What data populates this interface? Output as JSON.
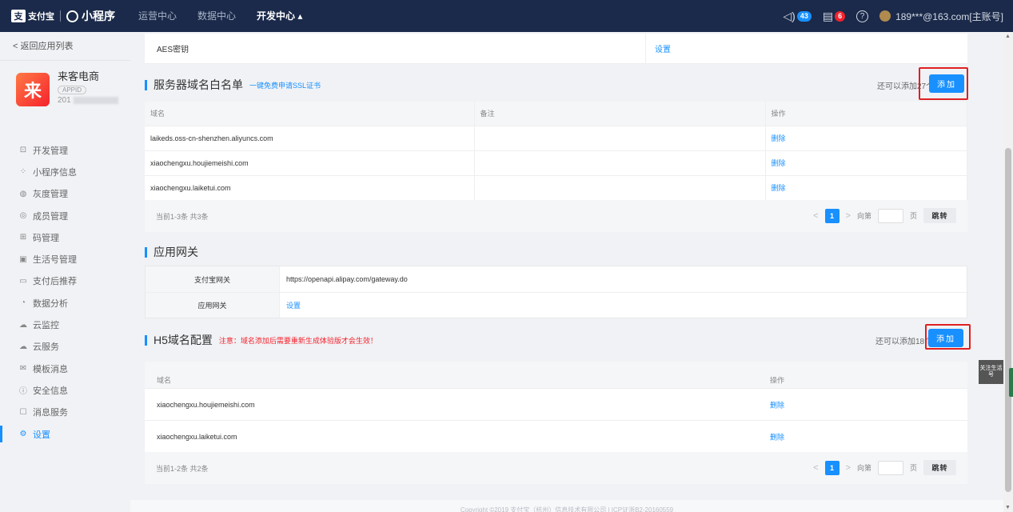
{
  "topbar": {
    "alipay_text": "支付宝",
    "mini_text": "小程序",
    "nav": [
      "运营中心",
      "数据中心",
      "开发中心 ▴"
    ],
    "msg_count": "43",
    "notice_count": "6",
    "account": "189***@163.com[主账号]"
  },
  "sidebar": {
    "back": "< 返回应用列表",
    "app_name": "来客电商",
    "app_logo_char": "来",
    "app_tag": "APPID",
    "app_id_prefix": "201",
    "items": [
      {
        "icon": "⊡",
        "label": "开发管理"
      },
      {
        "icon": "⁘",
        "label": "小程序信息"
      },
      {
        "icon": "◍",
        "label": "灰度管理"
      },
      {
        "icon": "◎",
        "label": "成员管理"
      },
      {
        "icon": "⊞",
        "label": "码管理"
      },
      {
        "icon": "▣",
        "label": "生活号管理"
      },
      {
        "icon": "▭",
        "label": "支付后推荐"
      },
      {
        "icon": "◔",
        "label": "数据分析"
      },
      {
        "icon": "☁",
        "label": "云监控"
      },
      {
        "icon": "☁",
        "label": "云服务"
      },
      {
        "icon": "✉",
        "label": "模板消息"
      },
      {
        "icon": "ⓘ",
        "label": "安全信息"
      },
      {
        "icon": "☐",
        "label": "消息服务"
      },
      {
        "icon": "⚙",
        "label": "设置"
      }
    ]
  },
  "aes": {
    "key": "AES密钥",
    "action": "设置"
  },
  "server_whitelist": {
    "title": "服务器域名白名单",
    "link": "一键免费申请SSL证书",
    "remain": "还可以添加27个",
    "add": "添加",
    "columns": [
      "域名",
      "备注",
      "操作"
    ],
    "rows": [
      {
        "domain": "laikeds.oss-cn-shenzhen.aliyuncs.com",
        "note": "",
        "op": "删除"
      },
      {
        "domain": "xiaochengxu.houjiemeishi.com",
        "note": "",
        "op": "删除"
      },
      {
        "domain": "xiaochengxu.laiketui.com",
        "note": "",
        "op": "删除"
      }
    ],
    "pager": {
      "total": "当前1-3条 共3条",
      "page": "1",
      "goto": "向第",
      "page_unit": "页",
      "jump": "跳转"
    }
  },
  "gateway": {
    "title": "应用网关",
    "rows": [
      {
        "k": "支付宝网关",
        "v": "https://openapi.alipay.com/gateway.do"
      },
      {
        "k": "应用网关",
        "v": "设置"
      }
    ]
  },
  "h5": {
    "title": "H5域名配置",
    "warn": "注意：域名添加后需要重新生成体验版才会生效！",
    "remain": "还可以添加18个",
    "add": "添加",
    "columns": [
      "域名",
      "操作"
    ],
    "rows": [
      {
        "domain": "xiaochengxu.houjiemeishi.com",
        "op": "删除"
      },
      {
        "domain": "xiaochengxu.laiketui.com",
        "op": "删除"
      }
    ],
    "pager": {
      "total": "当前1-2条 共2条",
      "page": "1",
      "goto": "向第",
      "page_unit": "页",
      "jump": "跳转"
    }
  },
  "footer": "Copyright ©2019 支付宝（杭州）信息技术有限公司 | ICP证浙B2-20160559",
  "follow_widget": "关注生活号",
  "colors": {
    "topbar": "#1b2a4a",
    "accent": "#1890ff",
    "warn": "#f5222d",
    "highlight": "#e02020"
  }
}
